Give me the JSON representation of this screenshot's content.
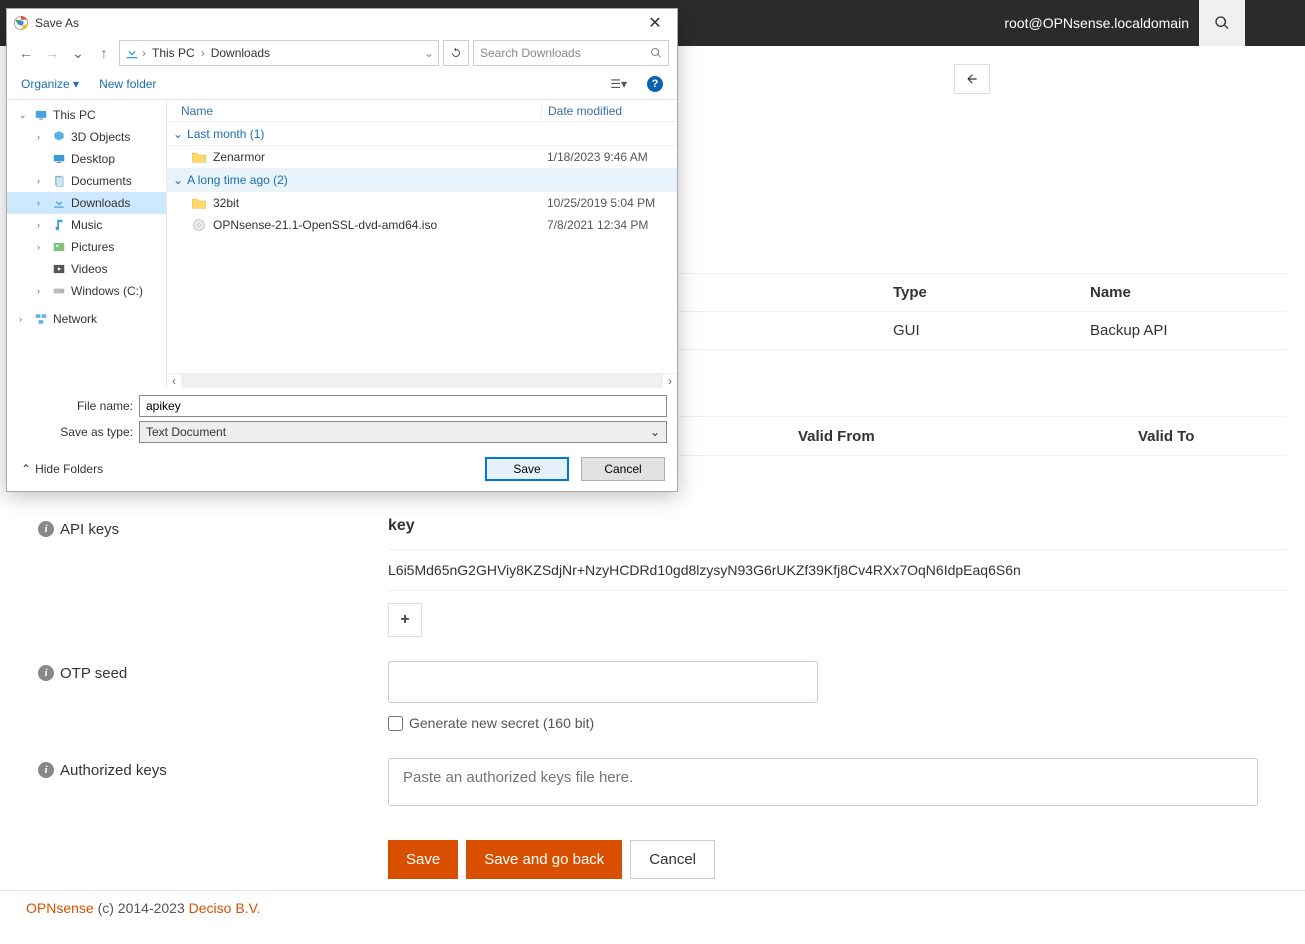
{
  "topbar": {
    "userhost": "root@OPNsense.localdomain"
  },
  "groups_table": {
    "hdr_type": "Type",
    "hdr_name": "Name",
    "row_type": "GUI",
    "row_name": "Backup API"
  },
  "valid_table": {
    "hdr_from": "Valid From",
    "hdr_to": "Valid To"
  },
  "api": {
    "label": "API keys",
    "key_hdr": "key",
    "key_val": "L6i5Md65nG2GHViy8KZSdjNr+NzyHCDRd10gd8lzysyN93G6rUKZf39Kfj8Cv4RXx7OqN6IdpEaq6S6n"
  },
  "otp": {
    "label": "OTP seed",
    "checkbox": "Generate new secret (160 bit)"
  },
  "auth": {
    "label": "Authorized keys",
    "placeholder": "Paste an authorized keys file here."
  },
  "actions": {
    "save": "Save",
    "save_back": "Save and go back",
    "cancel": "Cancel"
  },
  "footer": {
    "brand": "OPNsense",
    "mid": " (c) 2014-2023 ",
    "company": "Deciso B.V."
  },
  "saveas": {
    "title": "Save As",
    "crumb1": "This PC",
    "crumb2": "Downloads",
    "search_ph": "Search Downloads",
    "organize": "Organize",
    "newfolder": "New folder",
    "col_name": "Name",
    "col_date": "Date modified",
    "grp1": "Last month (1)",
    "grp2": "A long time ago (2)",
    "files": {
      "f1_name": "Zenarmor",
      "f1_date": "1/18/2023 9:46 AM",
      "f2_name": "32bit",
      "f2_date": "10/25/2019 5:04 PM",
      "f3_name": "OPNsense-21.1-OpenSSL-dvd-amd64.iso",
      "f3_date": "7/8/2021 12:34 PM"
    },
    "tree": {
      "thispc": "This PC",
      "3d": "3D Objects",
      "desktop": "Desktop",
      "documents": "Documents",
      "downloads": "Downloads",
      "music": "Music",
      "pictures": "Pictures",
      "videos": "Videos",
      "cdrive": "Windows (C:)",
      "network": "Network"
    },
    "fn_label": "File name:",
    "fn_value": "apikey",
    "type_label": "Save as type:",
    "type_value": "Text Document",
    "hide": "Hide Folders",
    "btn_save": "Save",
    "btn_cancel": "Cancel"
  }
}
